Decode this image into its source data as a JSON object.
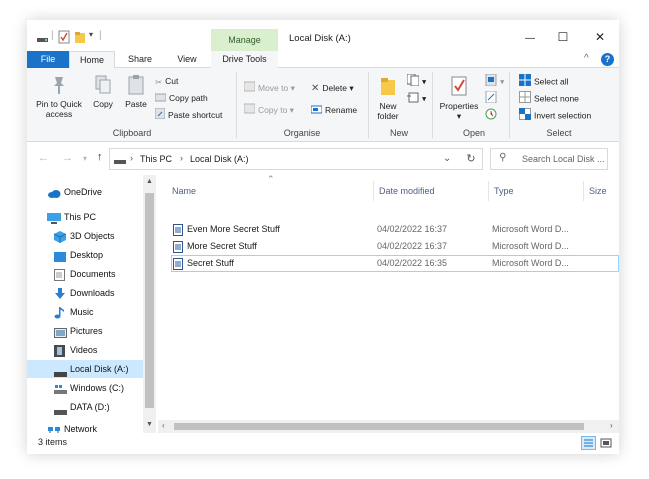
{
  "window": {
    "title": "Local Disk (A:)",
    "contextual_tab": "Manage",
    "controls": {
      "minimize": "—",
      "maximize": "☐",
      "close": "✕"
    }
  },
  "ribbon_tabs": {
    "file": "File",
    "home": "Home",
    "share": "Share",
    "view": "View",
    "drive_tools": "Drive Tools",
    "minimize_glyph": "^",
    "help_glyph": "?"
  },
  "ribbon": {
    "clipboard": {
      "label": "Clipboard",
      "pin": [
        "Pin to Quick",
        "access"
      ],
      "copy": "Copy",
      "paste": "Paste",
      "cut": "Cut",
      "copy_path": "Copy path",
      "paste_shortcut": "Paste shortcut"
    },
    "organise": {
      "label": "Organise",
      "move_to": "Move to",
      "copy_to": "Copy to",
      "delete": "Delete",
      "rename": "Rename"
    },
    "new": {
      "label": "New",
      "new_folder": [
        "New",
        "folder"
      ]
    },
    "open": {
      "label": "Open",
      "properties": "Properties"
    },
    "select": {
      "label": "Select",
      "select_all": "Select all",
      "select_none": "Select none",
      "invert_selection": "Invert selection"
    }
  },
  "address": {
    "path": [
      "This PC",
      "Local Disk (A:)"
    ],
    "search_placeholder": "Search Local Disk ..."
  },
  "nav_pane": {
    "items": [
      {
        "label": "OneDrive",
        "icon": "cloud-icon"
      },
      {
        "label": "This PC",
        "icon": "computer-icon"
      },
      {
        "label": "3D Objects",
        "icon": "cube-icon"
      },
      {
        "label": "Desktop",
        "icon": "desktop-icon"
      },
      {
        "label": "Documents",
        "icon": "documents-icon"
      },
      {
        "label": "Downloads",
        "icon": "download-arrow-icon"
      },
      {
        "label": "Music",
        "icon": "music-note-icon"
      },
      {
        "label": "Pictures",
        "icon": "pictures-icon"
      },
      {
        "label": "Videos",
        "icon": "film-icon"
      },
      {
        "label": "Local Disk (A:)",
        "icon": "drive-icon",
        "selected": true
      },
      {
        "label": "Windows (C:)",
        "icon": "windows-drive-icon"
      },
      {
        "label": "DATA (D:)",
        "icon": "drive-icon"
      },
      {
        "label": "Network",
        "icon": "network-icon"
      }
    ]
  },
  "file_list": {
    "columns": [
      "Name",
      "Date modified",
      "Type",
      "Size"
    ],
    "rows": [
      {
        "name": "Even More Secret Stuff",
        "modified": "04/02/2022 16:37",
        "type": "Microsoft Word D...",
        "icon": "word-document-icon"
      },
      {
        "name": "More Secret Stuff",
        "modified": "04/02/2022 16:37",
        "type": "Microsoft Word D...",
        "icon": "word-document-icon"
      },
      {
        "name": "Secret Stuff",
        "modified": "04/02/2022 16:35",
        "type": "Microsoft Word D...",
        "icon": "word-document-icon",
        "selected": true
      }
    ]
  },
  "status": {
    "item_count": "3 items"
  },
  "colors": {
    "accent": "#1a73c8",
    "manage_tab": "#d9efce",
    "selection": "#cce8ff"
  }
}
